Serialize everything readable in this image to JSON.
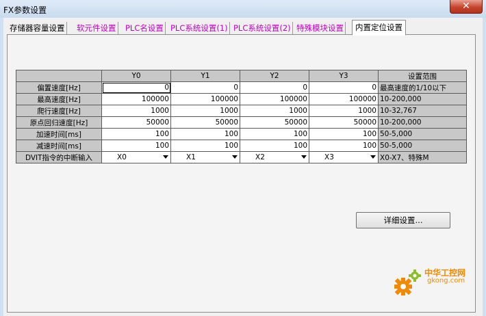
{
  "window": {
    "title": "FX参数设置",
    "close_label": "✕"
  },
  "tabs": [
    {
      "label": "存储器容量设置"
    },
    {
      "label": "软元件设置"
    },
    {
      "label": "PLC名设置"
    },
    {
      "label": "PLC系统设置(1)"
    },
    {
      "label": "PLC系统设置(2)"
    },
    {
      "label": "特殊模块设置"
    },
    {
      "label": "内置定位设置"
    }
  ],
  "active_tab": "内置定位设置",
  "table": {
    "columns": [
      "Y0",
      "Y1",
      "Y2",
      "Y3",
      "设置范围"
    ],
    "rows": [
      {
        "label": "偏置速度[Hz]",
        "values": [
          "0",
          "0",
          "0",
          "0"
        ],
        "range": "最高速度的1/10以下"
      },
      {
        "label": "最高速度[Hz]",
        "values": [
          "100000",
          "100000",
          "100000",
          "100000"
        ],
        "range": "10-200,000"
      },
      {
        "label": "爬行速度[Hz]",
        "values": [
          "1000",
          "1000",
          "1000",
          "1000"
        ],
        "range": "10-32,767"
      },
      {
        "label": "原点回归速度[Hz]",
        "values": [
          "50000",
          "50000",
          "50000",
          "50000"
        ],
        "range": "10-200,000"
      },
      {
        "label": "加速时间[ms]",
        "values": [
          "100",
          "100",
          "100",
          "100"
        ],
        "range": "50-5,000"
      },
      {
        "label": "减速时间[ms]",
        "values": [
          "100",
          "100",
          "100",
          "100"
        ],
        "range": "50-5,000"
      }
    ],
    "dvit_row": {
      "label": "DVIT指令的中断输入",
      "values": [
        "X0",
        "X1",
        "X2",
        "X3"
      ],
      "range": "X0-X7、特殊M"
    }
  },
  "buttons": {
    "detail": "详细设置..."
  },
  "watermark": {
    "line1": "中华工控网",
    "line2": "gkong.com"
  },
  "colors": {
    "tab_text": "#c000c0",
    "header_bg": "#c8c8c8",
    "watermark": "#f08a00"
  }
}
